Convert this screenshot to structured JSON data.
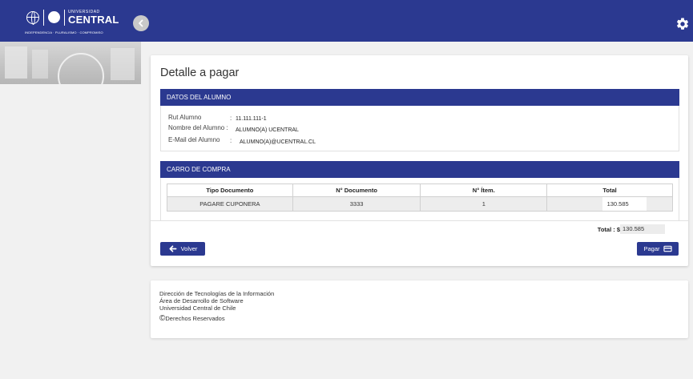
{
  "header": {
    "logo_top": "UNIVERSIDAD",
    "logo_name": "CENTRAL",
    "logo_motto": "INDEPENDENCIA · PLURALISMO · COMPROMISO"
  },
  "page": {
    "title": "Detalle a pagar"
  },
  "student": {
    "section_title": "DATOS DEL ALUMNO",
    "rut_label": "Rut Alumno",
    "rut_sep": ":",
    "rut_value": "11.111.111-1",
    "name_label": "Nombre del Alumno :",
    "name_value": "ALUMNO(A) UCENTRAL",
    "email_label": "E-Mail del Alumno",
    "email_sep": ":",
    "email_value": "ALUMNO(A)@UCENTRAL.CL"
  },
  "cart": {
    "section_title": "CARRO DE COMPRA",
    "columns": [
      "Tipo Documento",
      "N° Documento",
      "N° Ítem.",
      "Total"
    ],
    "rows": [
      {
        "tipo": "PAGARE CUPONERA",
        "documento": "3333",
        "item": "1",
        "total": "130.585"
      }
    ],
    "total_label": "Total : $",
    "total_value": "130.585"
  },
  "actions": {
    "back_label": "Volver",
    "pay_label": "Pagar"
  },
  "footer": {
    "line1": "Dirección de Tecnologías de la Información",
    "line2": "Área de Desarrollo de Software",
    "line3": "Universidad Central de Chile",
    "copyright_symbol": "©",
    "line4": "Derechos Reservados"
  },
  "colors": {
    "primary": "#2b3990",
    "background": "#f1f1f1",
    "row_bg": "#ededed"
  },
  "icons": [
    "globe-icon",
    "chevron-left-icon",
    "gear-icon",
    "arrow-left-icon",
    "credit-card-icon"
  ]
}
